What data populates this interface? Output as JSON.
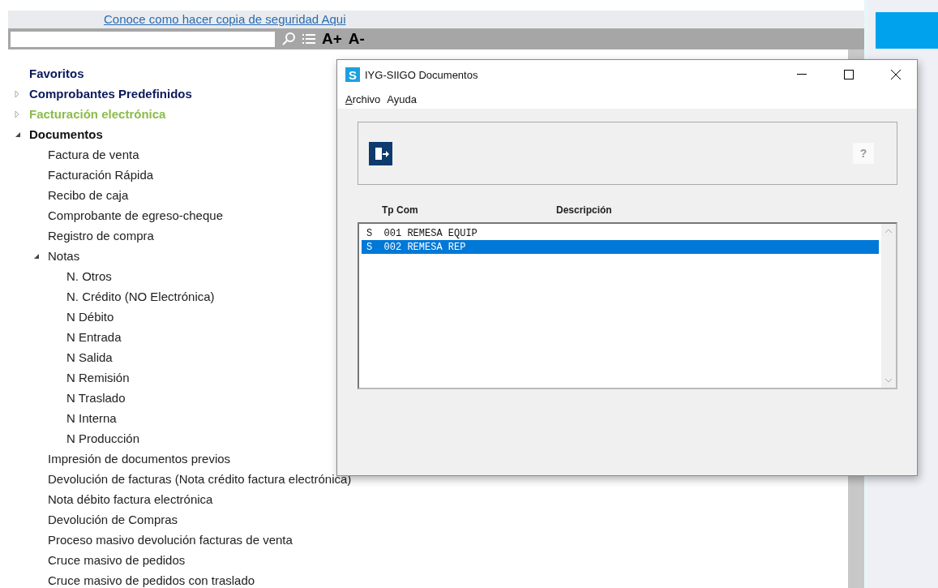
{
  "backup_link": "Conoce como hacer copia de seguridad Aqui",
  "toolbar": {
    "font_increase": "A+",
    "font_decrease": "A-"
  },
  "tree": [
    {
      "label": "Favoritos",
      "kind": "header",
      "color": "#0c1a5c"
    },
    {
      "label": "Comprobantes Predefinidos",
      "kind": "group",
      "expanded": false,
      "color": "#0c1a5c"
    },
    {
      "label": "Facturación electrónica",
      "kind": "group",
      "expanded": false,
      "color": "#8cbc4c"
    },
    {
      "label": "Documentos",
      "kind": "group",
      "expanded": true,
      "color": "#111111",
      "children": [
        {
          "label": "Factura de venta",
          "kind": "leaf"
        },
        {
          "label": "Facturación Rápida",
          "kind": "leaf"
        },
        {
          "label": "Recibo de caja",
          "kind": "leaf"
        },
        {
          "label": "Comprobante de egreso-cheque",
          "kind": "leaf"
        },
        {
          "label": "Registro de compra",
          "kind": "leaf"
        },
        {
          "label": "Notas",
          "kind": "group",
          "expanded": true,
          "children": [
            {
              "label": "N. Otros",
              "kind": "leaf"
            },
            {
              "label": "N. Crédito (NO Electrónica)",
              "kind": "leaf"
            },
            {
              "label": "N Débito",
              "kind": "leaf"
            },
            {
              "label": "N Entrada",
              "kind": "leaf"
            },
            {
              "label": "N Salida",
              "kind": "leaf"
            },
            {
              "label": "N Remisión",
              "kind": "leaf"
            },
            {
              "label": "N Traslado",
              "kind": "leaf"
            },
            {
              "label": "N Interna",
              "kind": "leaf"
            },
            {
              "label": "N Producción",
              "kind": "leaf"
            }
          ]
        },
        {
          "label": "Impresión de documentos previos",
          "kind": "leaf"
        },
        {
          "label": "Devolución de facturas (Nota crédito factura electrónica)",
          "kind": "leaf"
        },
        {
          "label": "Nota débito factura electrónica",
          "kind": "leaf"
        },
        {
          "label": "Devolución de Compras",
          "kind": "leaf"
        },
        {
          "label": "Proceso masivo devolución facturas de venta",
          "kind": "leaf"
        },
        {
          "label": "Cruce masivo de pedidos",
          "kind": "leaf"
        },
        {
          "label": "Cruce masivo de pedidos con traslado",
          "kind": "leaf"
        }
      ]
    }
  ],
  "dialog": {
    "app_icon": "S",
    "title": "IYG-SIIGO Documentos",
    "menu": [
      {
        "label": "Archivo",
        "mnemonic": true
      },
      {
        "label": "Ayuda",
        "mnemonic": false
      }
    ],
    "help": "?",
    "columns": [
      "Tp Com",
      "Descripción"
    ],
    "rows": [
      {
        "text": "S  001 REMESA EQUIP",
        "selected": false
      },
      {
        "text": "S  002 REMESA REP",
        "selected": true
      }
    ]
  }
}
